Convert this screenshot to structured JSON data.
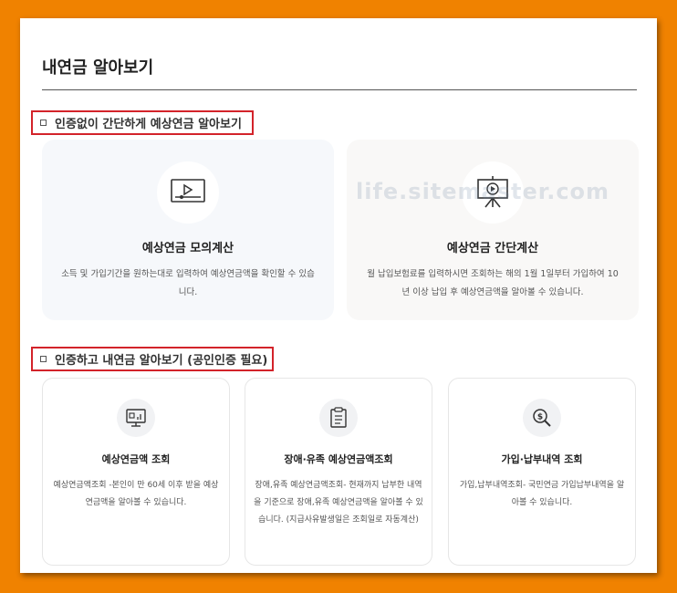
{
  "page": {
    "title": "내연금 알아보기",
    "watermark": "life.sitemaster.com"
  },
  "section1": {
    "label": "인증없이 간단하게 예상연금 알아보기",
    "cards": [
      {
        "icon": "video-player-icon",
        "title": "예상연금 모의계산",
        "desc": "소득 및 가입기간을 원하는대로 입력하여 예상연금액을 확인할 수 있습니다."
      },
      {
        "icon": "presentation-board-icon",
        "title": "예상연금 간단계산",
        "desc": "월 납입보험료를 입력하시면 조회하는 해의 1월 1일부터 가입하여 10년 이상 납입 후 예상연금액을 알아볼 수 있습니다."
      }
    ]
  },
  "section2": {
    "label": "인증하고 내연금 알아보기 (공인인증 필요)",
    "cards": [
      {
        "icon": "monitor-chart-icon",
        "title": "예상연금액 조회",
        "desc": "예상연금액조회 -본인이 만 60세 이후 받을 예상연금액을 알아볼 수 있습니다."
      },
      {
        "icon": "clipboard-icon",
        "title": "장애·유족 예상연금액조회",
        "desc": "장애,유족 예상연금액조회- 현재까지 납부한 내역을 기준으로 장애,유족 예상연금액을 알아볼 수 있습니다. (지급사유발생일은 조회일로 자동계산)"
      },
      {
        "icon": "money-search-icon",
        "title": "가입·납부내역 조회",
        "desc": "가입,납부내역조회- 국민연금 가입납부내역을 알아볼 수 있습니다."
      }
    ]
  },
  "colors": {
    "background": "#f08200",
    "highlight_border": "#d3232a"
  }
}
